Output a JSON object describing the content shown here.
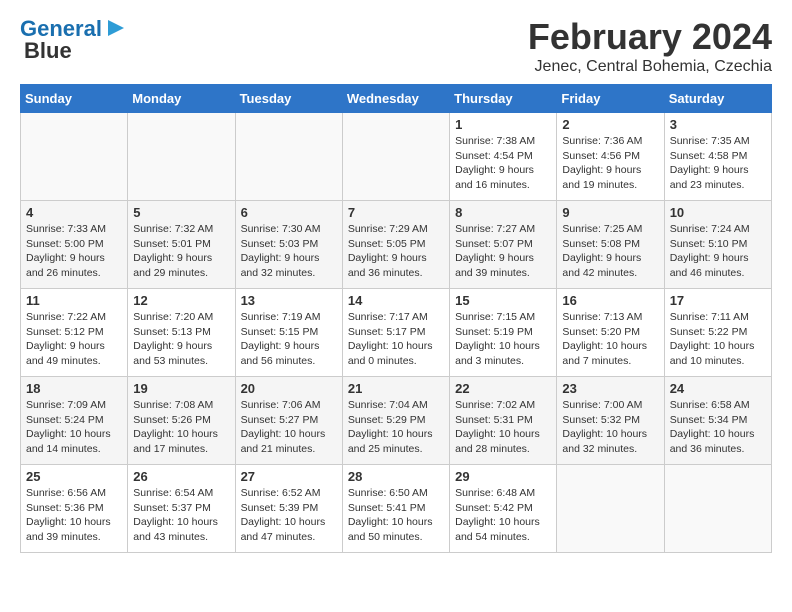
{
  "header": {
    "logo_general": "General",
    "logo_blue": "Blue",
    "title": "February 2024",
    "subtitle": "Jenec, Central Bohemia, Czechia"
  },
  "weekdays": [
    "Sunday",
    "Monday",
    "Tuesday",
    "Wednesday",
    "Thursday",
    "Friday",
    "Saturday"
  ],
  "weeks": [
    [
      {
        "day": "",
        "info": ""
      },
      {
        "day": "",
        "info": ""
      },
      {
        "day": "",
        "info": ""
      },
      {
        "day": "",
        "info": ""
      },
      {
        "day": "1",
        "info": "Sunrise: 7:38 AM\nSunset: 4:54 PM\nDaylight: 9 hours\nand 16 minutes."
      },
      {
        "day": "2",
        "info": "Sunrise: 7:36 AM\nSunset: 4:56 PM\nDaylight: 9 hours\nand 19 minutes."
      },
      {
        "day": "3",
        "info": "Sunrise: 7:35 AM\nSunset: 4:58 PM\nDaylight: 9 hours\nand 23 minutes."
      }
    ],
    [
      {
        "day": "4",
        "info": "Sunrise: 7:33 AM\nSunset: 5:00 PM\nDaylight: 9 hours\nand 26 minutes."
      },
      {
        "day": "5",
        "info": "Sunrise: 7:32 AM\nSunset: 5:01 PM\nDaylight: 9 hours\nand 29 minutes."
      },
      {
        "day": "6",
        "info": "Sunrise: 7:30 AM\nSunset: 5:03 PM\nDaylight: 9 hours\nand 32 minutes."
      },
      {
        "day": "7",
        "info": "Sunrise: 7:29 AM\nSunset: 5:05 PM\nDaylight: 9 hours\nand 36 minutes."
      },
      {
        "day": "8",
        "info": "Sunrise: 7:27 AM\nSunset: 5:07 PM\nDaylight: 9 hours\nand 39 minutes."
      },
      {
        "day": "9",
        "info": "Sunrise: 7:25 AM\nSunset: 5:08 PM\nDaylight: 9 hours\nand 42 minutes."
      },
      {
        "day": "10",
        "info": "Sunrise: 7:24 AM\nSunset: 5:10 PM\nDaylight: 9 hours\nand 46 minutes."
      }
    ],
    [
      {
        "day": "11",
        "info": "Sunrise: 7:22 AM\nSunset: 5:12 PM\nDaylight: 9 hours\nand 49 minutes."
      },
      {
        "day": "12",
        "info": "Sunrise: 7:20 AM\nSunset: 5:13 PM\nDaylight: 9 hours\nand 53 minutes."
      },
      {
        "day": "13",
        "info": "Sunrise: 7:19 AM\nSunset: 5:15 PM\nDaylight: 9 hours\nand 56 minutes."
      },
      {
        "day": "14",
        "info": "Sunrise: 7:17 AM\nSunset: 5:17 PM\nDaylight: 10 hours\nand 0 minutes."
      },
      {
        "day": "15",
        "info": "Sunrise: 7:15 AM\nSunset: 5:19 PM\nDaylight: 10 hours\nand 3 minutes."
      },
      {
        "day": "16",
        "info": "Sunrise: 7:13 AM\nSunset: 5:20 PM\nDaylight: 10 hours\nand 7 minutes."
      },
      {
        "day": "17",
        "info": "Sunrise: 7:11 AM\nSunset: 5:22 PM\nDaylight: 10 hours\nand 10 minutes."
      }
    ],
    [
      {
        "day": "18",
        "info": "Sunrise: 7:09 AM\nSunset: 5:24 PM\nDaylight: 10 hours\nand 14 minutes."
      },
      {
        "day": "19",
        "info": "Sunrise: 7:08 AM\nSunset: 5:26 PM\nDaylight: 10 hours\nand 17 minutes."
      },
      {
        "day": "20",
        "info": "Sunrise: 7:06 AM\nSunset: 5:27 PM\nDaylight: 10 hours\nand 21 minutes."
      },
      {
        "day": "21",
        "info": "Sunrise: 7:04 AM\nSunset: 5:29 PM\nDaylight: 10 hours\nand 25 minutes."
      },
      {
        "day": "22",
        "info": "Sunrise: 7:02 AM\nSunset: 5:31 PM\nDaylight: 10 hours\nand 28 minutes."
      },
      {
        "day": "23",
        "info": "Sunrise: 7:00 AM\nSunset: 5:32 PM\nDaylight: 10 hours\nand 32 minutes."
      },
      {
        "day": "24",
        "info": "Sunrise: 6:58 AM\nSunset: 5:34 PM\nDaylight: 10 hours\nand 36 minutes."
      }
    ],
    [
      {
        "day": "25",
        "info": "Sunrise: 6:56 AM\nSunset: 5:36 PM\nDaylight: 10 hours\nand 39 minutes."
      },
      {
        "day": "26",
        "info": "Sunrise: 6:54 AM\nSunset: 5:37 PM\nDaylight: 10 hours\nand 43 minutes."
      },
      {
        "day": "27",
        "info": "Sunrise: 6:52 AM\nSunset: 5:39 PM\nDaylight: 10 hours\nand 47 minutes."
      },
      {
        "day": "28",
        "info": "Sunrise: 6:50 AM\nSunset: 5:41 PM\nDaylight: 10 hours\nand 50 minutes."
      },
      {
        "day": "29",
        "info": "Sunrise: 6:48 AM\nSunset: 5:42 PM\nDaylight: 10 hours\nand 54 minutes."
      },
      {
        "day": "",
        "info": ""
      },
      {
        "day": "",
        "info": ""
      }
    ]
  ]
}
